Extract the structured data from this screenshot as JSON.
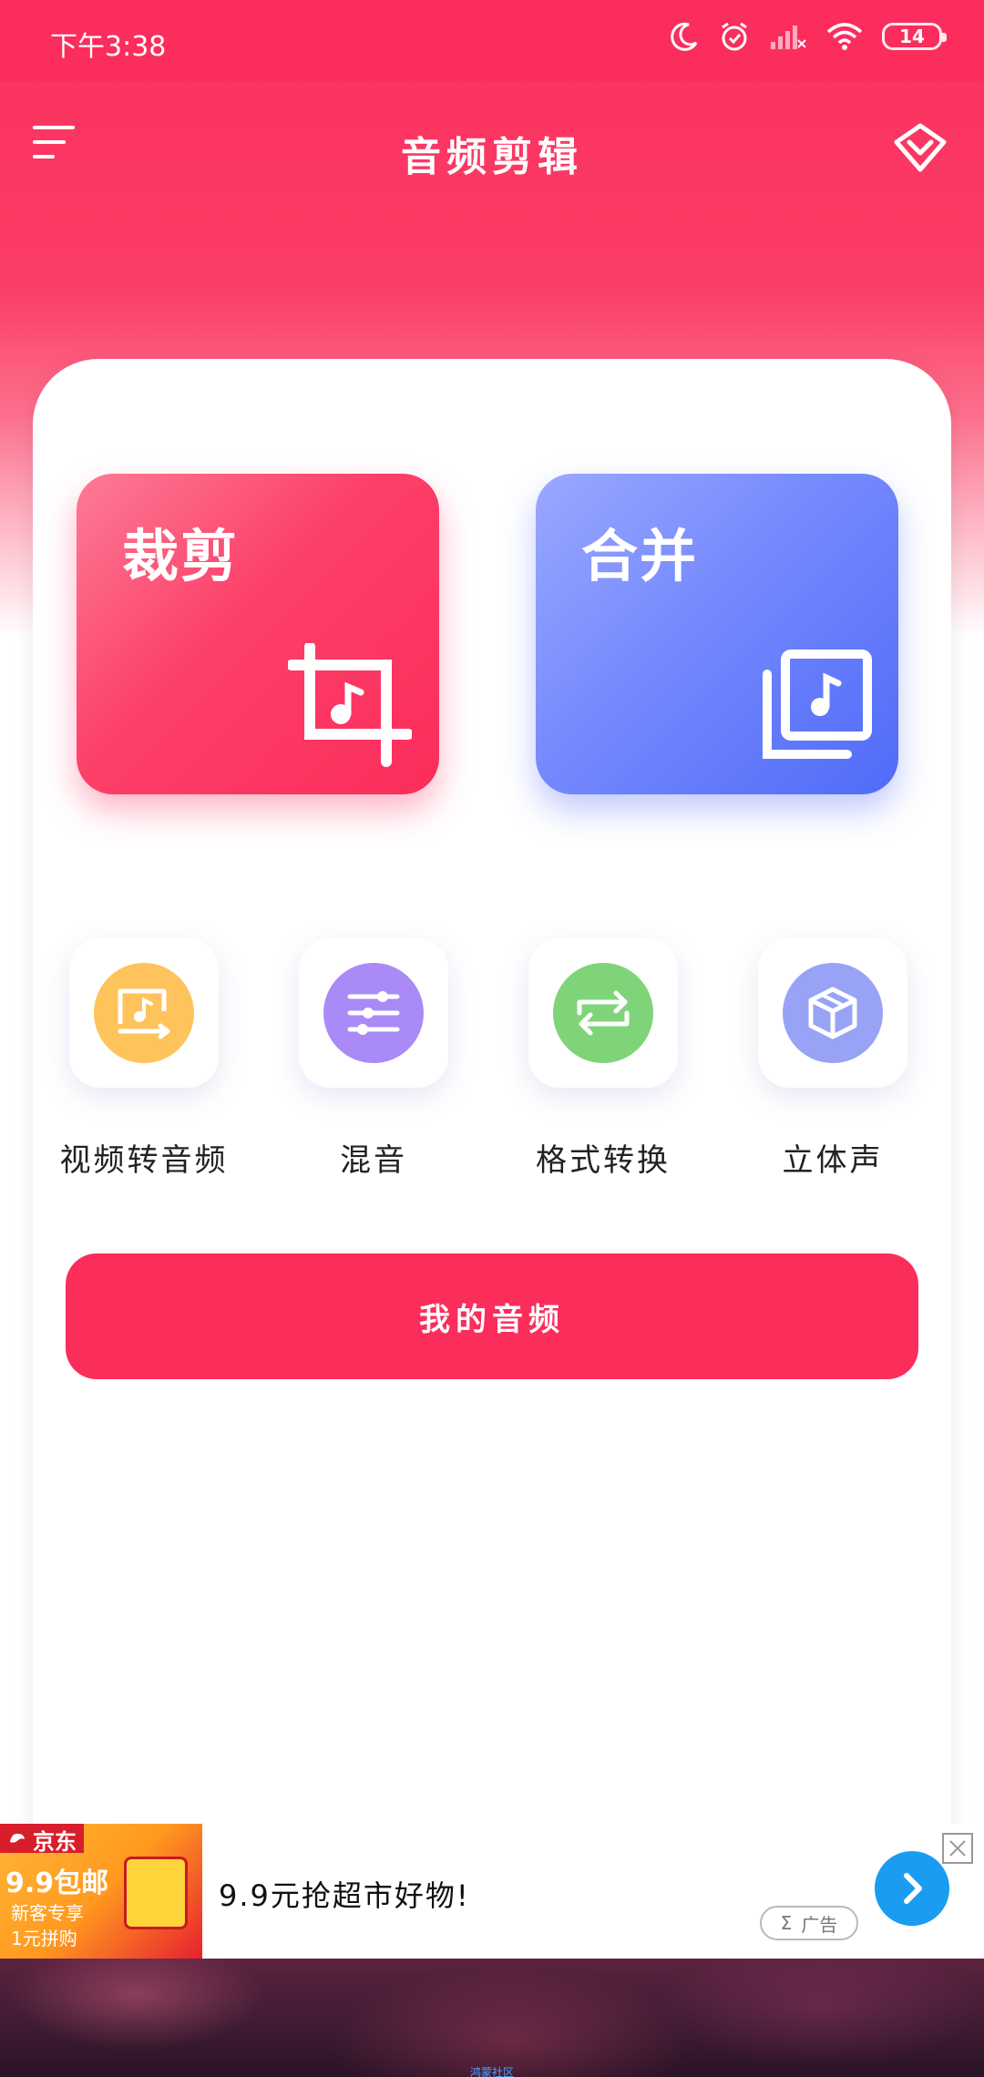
{
  "status_bar": {
    "time": "下午3:38",
    "battery": "14"
  },
  "header": {
    "title": "音频剪辑",
    "menu_icon": "menu-lines-icon",
    "vip_icon": "diamond-heart-icon"
  },
  "main_tiles": [
    {
      "label": "裁剪",
      "icon": "crop-music-icon",
      "color": "#fb2d5b"
    },
    {
      "label": "合并",
      "icon": "layers-music-icon",
      "color": "#4f6bf8"
    }
  ],
  "tools": [
    {
      "label": "视频转音频",
      "icon": "video-to-audio-icon",
      "color": "#ffc35c"
    },
    {
      "label": "混音",
      "icon": "equalizer-sliders-icon",
      "color": "#a98af6"
    },
    {
      "label": "格式转换",
      "icon": "swap-arrows-icon",
      "color": "#7fd47a"
    },
    {
      "label": "立体声",
      "icon": "cube-icon",
      "color": "#98a3f6"
    }
  ],
  "my_audio_button": "我的音频",
  "ad": {
    "brand": "京东",
    "promo": "9.9包邮",
    "sub1": "新客专享",
    "sub2": "1元拼购",
    "headline": "9.9元抢超市好物!",
    "badge_symbol": "Σ",
    "badge_text": "广告"
  },
  "footer_caption": "鸿蒙社区",
  "colors": {
    "primary": "#fb2d5b",
    "merge_blue": "#4f6bf8",
    "ad_go": "#1a9cf1"
  }
}
